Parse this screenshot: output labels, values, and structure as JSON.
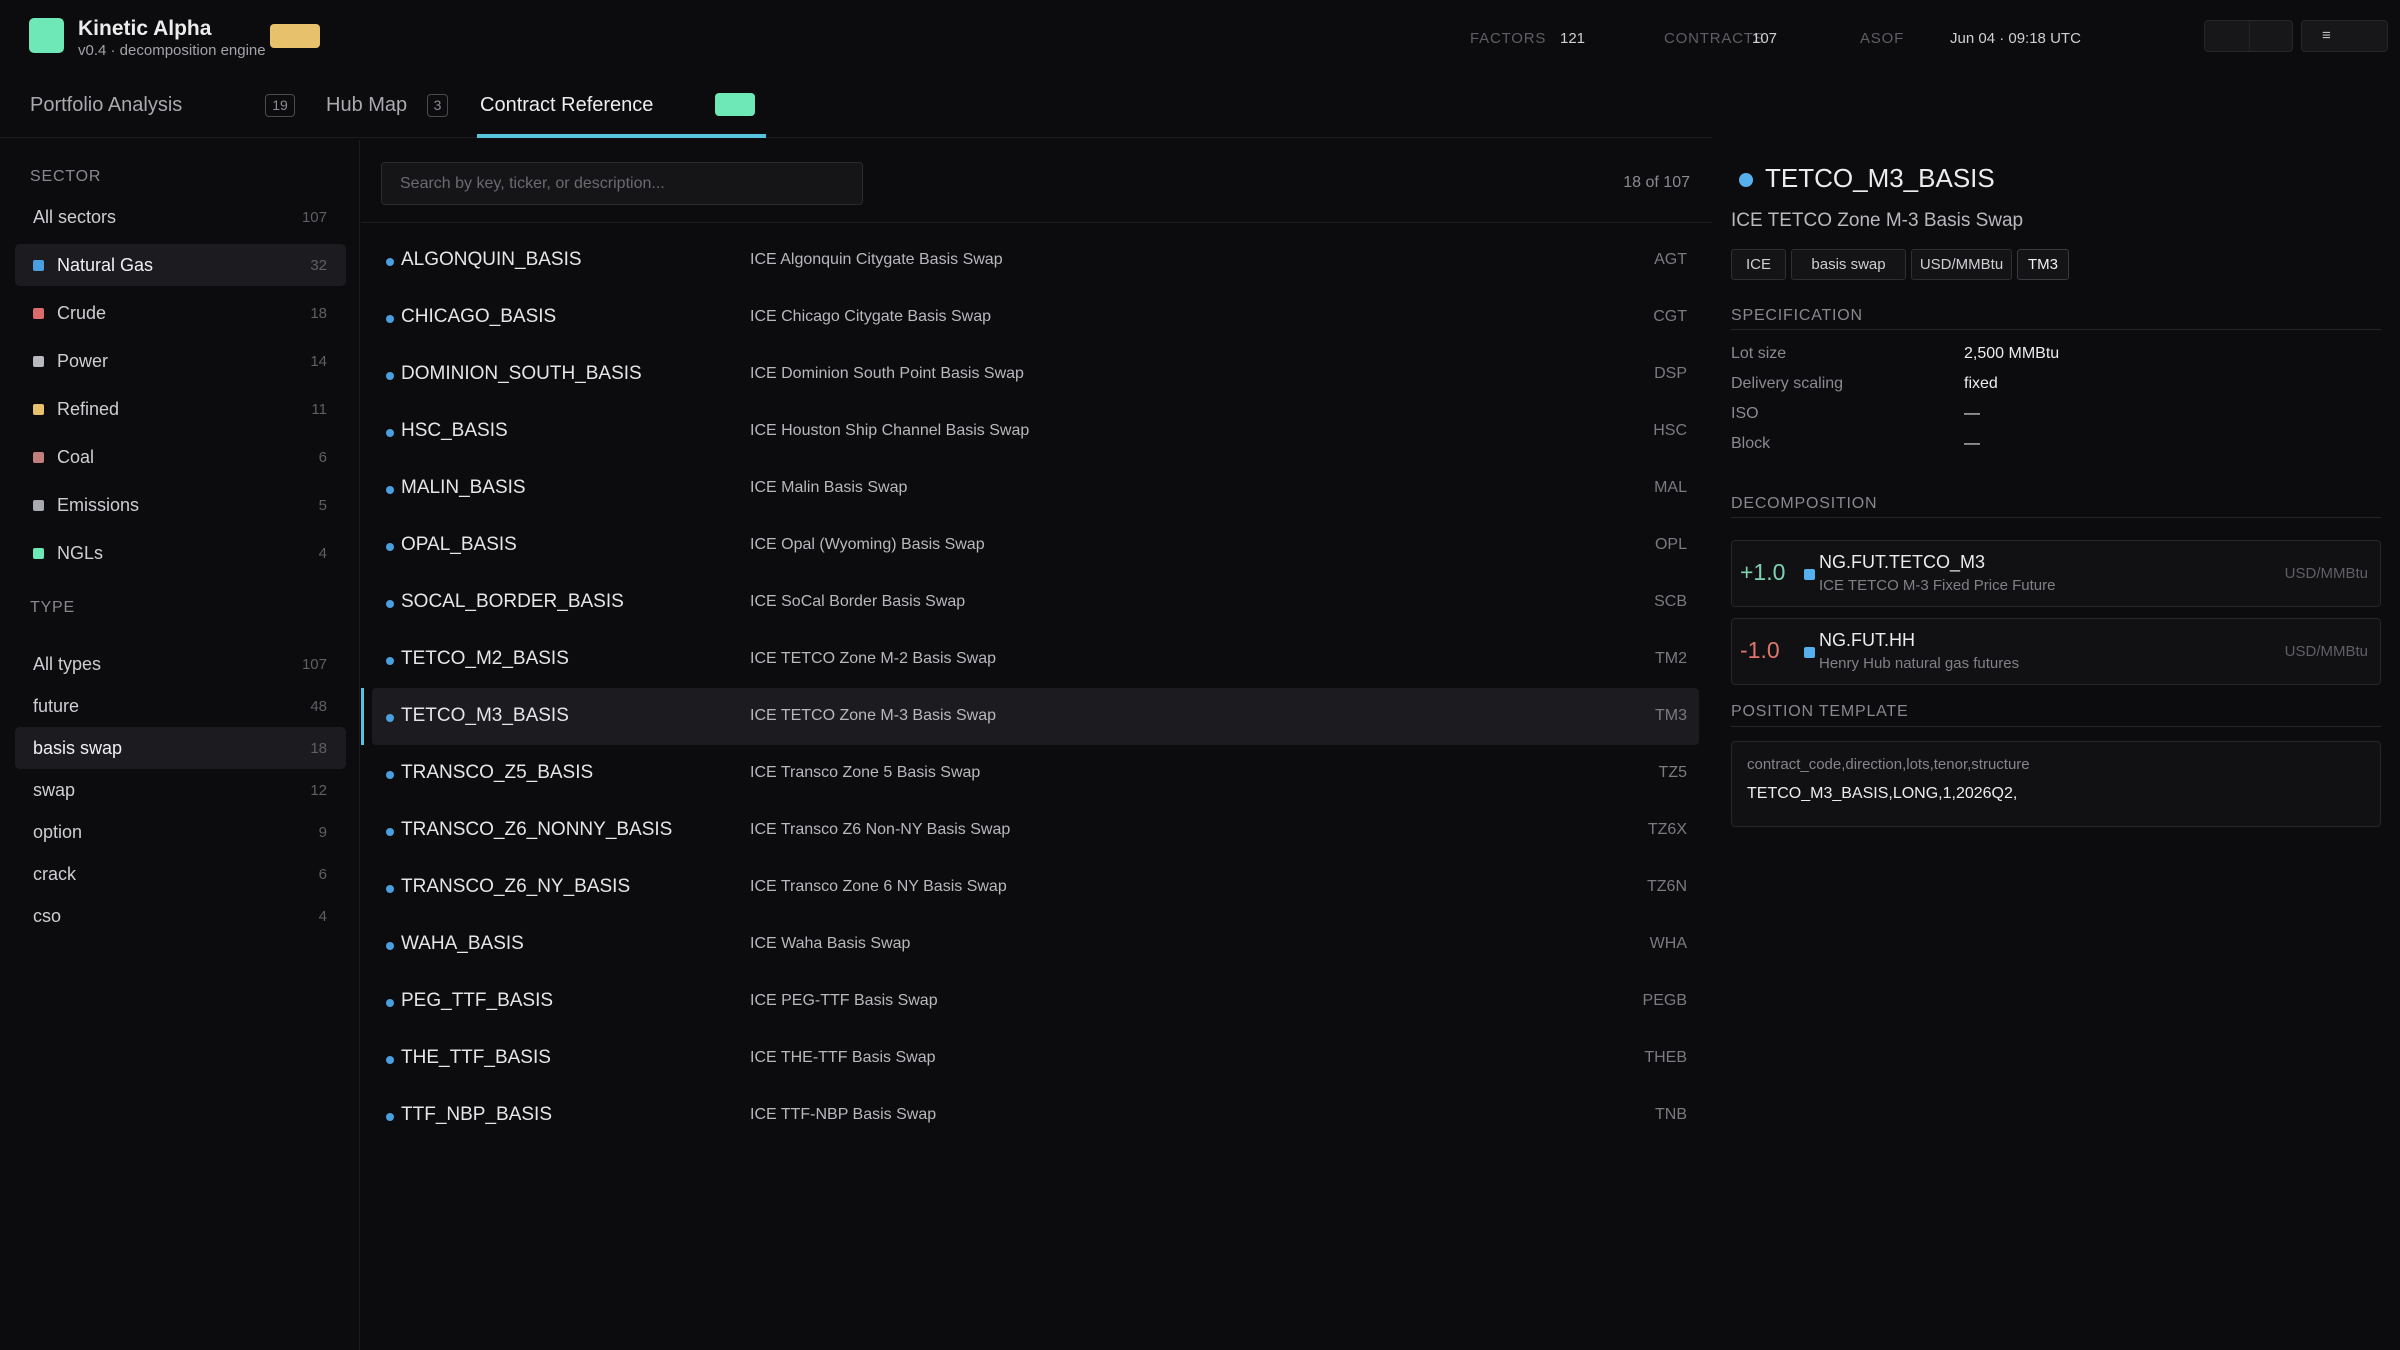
{
  "app": {
    "name": "Kinetic Alpha",
    "subtitle": "v0.4 · decomposition engine",
    "brand_color": "#6ee8b7",
    "pill_color": "#e7c16c"
  },
  "stats": [
    {
      "label": "FACTORS",
      "value": "121"
    },
    {
      "label": "CONTRACTS",
      "value": "107"
    },
    {
      "label": "ASOF",
      "value": "Jun 04 · 09:18 UTC"
    }
  ],
  "header_buttons": {
    "menu_icon": "hamburger-icon",
    "menu_glyph": "≡"
  },
  "tabs": [
    {
      "label": "Portfolio Analysis",
      "badge": "19"
    },
    {
      "label": "Hub Map",
      "badge": "3"
    },
    {
      "label": "Contract Reference",
      "active": true
    }
  ],
  "sidebar": {
    "sector_title": "SECTOR",
    "sectors": [
      {
        "label": "All sectors",
        "count": "107"
      },
      {
        "label": "Natural Gas",
        "count": "32",
        "color": "#4a9fe0",
        "selected": true
      },
      {
        "label": "Crude",
        "count": "18",
        "color": "#dc6b6b"
      },
      {
        "label": "Power",
        "count": "14",
        "color": "#b9b9c0"
      },
      {
        "label": "Refined",
        "count": "11",
        "color": "#e7c16c"
      },
      {
        "label": "Coal",
        "count": "6",
        "color": "#c27d7d"
      },
      {
        "label": "Emissions",
        "count": "5",
        "color": "#a9a9b0"
      },
      {
        "label": "NGLs",
        "count": "4",
        "color": "#6ee8b7"
      }
    ],
    "type_title": "TYPE",
    "types": [
      {
        "label": "All types",
        "count": "107"
      },
      {
        "label": "future",
        "count": "48"
      },
      {
        "label": "basis swap",
        "count": "18",
        "selected": true
      },
      {
        "label": "swap",
        "count": "12"
      },
      {
        "label": "option",
        "count": "9"
      },
      {
        "label": "crack",
        "count": "6"
      },
      {
        "label": "cso",
        "count": "4"
      }
    ]
  },
  "list": {
    "search_placeholder": "Search by key, ticker, or description...",
    "result_count": "18 of 107",
    "rows": [
      {
        "key": "ALGONQUIN_BASIS",
        "desc": "ICE Algonquin Citygate Basis Swap",
        "ticker": "AGT"
      },
      {
        "key": "CHICAGO_BASIS",
        "desc": "ICE Chicago Citygate Basis Swap",
        "ticker": "CGT"
      },
      {
        "key": "DOMINION_SOUTH_BASIS",
        "desc": "ICE Dominion South Point Basis Swap",
        "ticker": "DSP"
      },
      {
        "key": "HSC_BASIS",
        "desc": "ICE Houston Ship Channel Basis Swap",
        "ticker": "HSC"
      },
      {
        "key": "MALIN_BASIS",
        "desc": "ICE Malin Basis Swap",
        "ticker": "MAL"
      },
      {
        "key": "OPAL_BASIS",
        "desc": "ICE Opal (Wyoming) Basis Swap",
        "ticker": "OPL"
      },
      {
        "key": "SOCAL_BORDER_BASIS",
        "desc": "ICE SoCal Border Basis Swap",
        "ticker": "SCB"
      },
      {
        "key": "TETCO_M2_BASIS",
        "desc": "ICE TETCO Zone M-2 Basis Swap",
        "ticker": "TM2"
      },
      {
        "key": "TETCO_M3_BASIS",
        "desc": "ICE TETCO Zone M-3 Basis Swap",
        "ticker": "TM3",
        "selected": true
      },
      {
        "key": "TRANSCO_Z5_BASIS",
        "desc": "ICE Transco Zone 5 Basis Swap",
        "ticker": "TZ5"
      },
      {
        "key": "TRANSCO_Z6_NONNY_BASIS",
        "desc": "ICE Transco Z6 Non-NY Basis Swap",
        "ticker": "TZ6X"
      },
      {
        "key": "TRANSCO_Z6_NY_BASIS",
        "desc": "ICE Transco Zone 6 NY Basis Swap",
        "ticker": "TZ6N"
      },
      {
        "key": "WAHA_BASIS",
        "desc": "ICE Waha Basis Swap",
        "ticker": "WHA"
      },
      {
        "key": "PEG_TTF_BASIS",
        "desc": "ICE PEG-TTF Basis Swap",
        "ticker": "PEGB"
      },
      {
        "key": "THE_TTF_BASIS",
        "desc": "ICE THE-TTF Basis Swap",
        "ticker": "THEB"
      },
      {
        "key": "TTF_NBP_BASIS",
        "desc": "ICE TTF-NBP Basis Swap",
        "ticker": "TNB"
      }
    ]
  },
  "detail": {
    "title": "TETCO_M3_BASIS",
    "subtitle": "ICE TETCO Zone M-3 Basis Swap",
    "tags": [
      "ICE",
      "basis swap",
      "USD/MMBtu",
      "TM3"
    ],
    "spec_title": "SPECIFICATION",
    "spec": [
      {
        "label": "Lot size",
        "value": "2,500 MMBtu"
      },
      {
        "label": "Delivery scaling",
        "value": "fixed"
      },
      {
        "label": "ISO",
        "value": "—"
      },
      {
        "label": "Block",
        "value": "—"
      }
    ],
    "decomp_title": "DECOMPOSITION",
    "decomposition": [
      {
        "weight": "+1.0",
        "code": "NG.FUT.TETCO_M3",
        "desc": "ICE TETCO M-3 Fixed Price Future",
        "unit": "USD/MMBtu",
        "sign": "pos"
      },
      {
        "weight": "-1.0",
        "code": "NG.FUT.HH",
        "desc": "Henry Hub natural gas futures",
        "unit": "USD/MMBtu",
        "sign": "neg"
      }
    ],
    "template_title": "POSITION TEMPLATE",
    "template_header": "contract_code,direction,lots,tenor,structure",
    "template_row": "TETCO_M3_BASIS,LONG,1,2026Q2,"
  }
}
